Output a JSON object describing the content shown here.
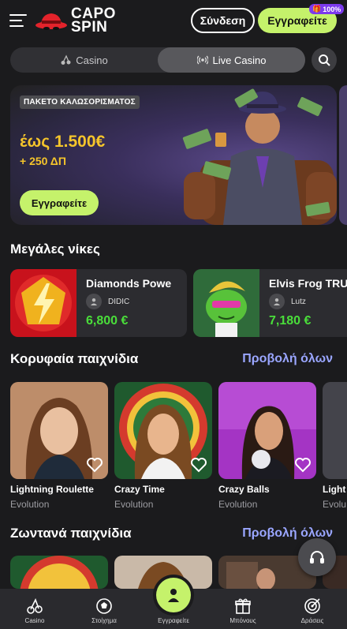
{
  "header": {
    "logo_line1": "CAPO",
    "logo_line2": "SPIN",
    "login_label": "Σύνδεση",
    "register_label": "Εγγραφείτε",
    "bonus_badge": "100%"
  },
  "tabs": [
    {
      "label": "Casino",
      "icon": "cherries-icon",
      "active": false
    },
    {
      "label": "Live Casino",
      "icon": "live-signal-icon",
      "active": true
    }
  ],
  "banner": {
    "tag": "ΠΑΚΕΤΟ ΚΑΛΩΣΟΡΙΣΜΑΤΟΣ",
    "amount": "έως 1.500€",
    "sub": "+ 250 ΔΠ",
    "button_label": "Εγγραφείτε"
  },
  "big_wins": {
    "title": "Μεγάλες νίκες",
    "items": [
      {
        "game": "Diamonds Powe",
        "user": "DIDIC",
        "amount": "6,800 €"
      },
      {
        "game": "Elvis Frog TRU",
        "user": "Lutz",
        "amount": "7,180 €"
      }
    ]
  },
  "top_games": {
    "title": "Κορυφαία παιχνίδια",
    "view_all": "Προβολή όλων",
    "items": [
      {
        "title": "Lightning Roulette",
        "provider": "Evolution"
      },
      {
        "title": "Crazy Time",
        "provider": "Evolution"
      },
      {
        "title": "Crazy Balls",
        "provider": "Evolution"
      },
      {
        "title": "Light",
        "provider": "Evolu"
      }
    ]
  },
  "live_games": {
    "title": "Ζωντανά παιχνίδια",
    "view_all": "Προβολή όλων"
  },
  "bottom_nav": [
    {
      "label": "Casino",
      "icon": "cherries-icon"
    },
    {
      "label": "Στοίχημα",
      "icon": "football-icon"
    },
    {
      "label": "Εγγραφείτε",
      "icon": "user-icon"
    },
    {
      "label": "Μπόνους",
      "icon": "gift-icon"
    },
    {
      "label": "Δράσεις",
      "icon": "target-icon"
    }
  ],
  "colors": {
    "accent": "#c5f26b",
    "gold": "#f5c52b",
    "win_green": "#4ade3a",
    "link": "#9aa6ff",
    "background": "#1b1b1d"
  }
}
